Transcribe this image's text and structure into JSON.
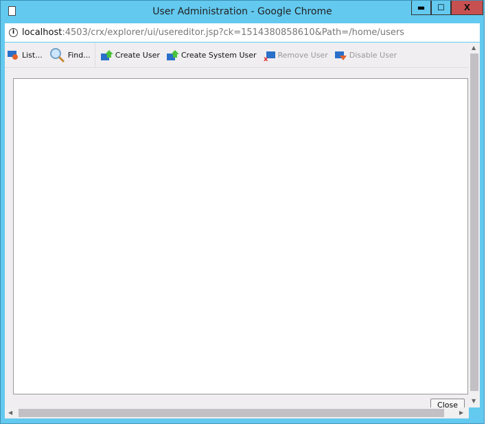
{
  "window": {
    "title": "User Administration - Google Chrome",
    "minimize": "▬",
    "maximize": "☐",
    "close": "X"
  },
  "address": {
    "host": "localhost",
    "rest": ":4503/crx/explorer/ui/usereditor.jsp?ck=1514380858610&Path=/home/users"
  },
  "toolbar": {
    "items": [
      {
        "label": "List...",
        "enabled": true
      },
      {
        "label": "Find...",
        "enabled": true
      },
      {
        "label": "Create User",
        "enabled": true
      },
      {
        "label": "Create System User",
        "enabled": true
      },
      {
        "label": "Remove User",
        "enabled": false
      },
      {
        "label": "Disable User",
        "enabled": false
      }
    ]
  },
  "footer": {
    "close_label": "Close"
  },
  "colors": {
    "frame": "#63c9ef",
    "close_button": "#c75050"
  }
}
